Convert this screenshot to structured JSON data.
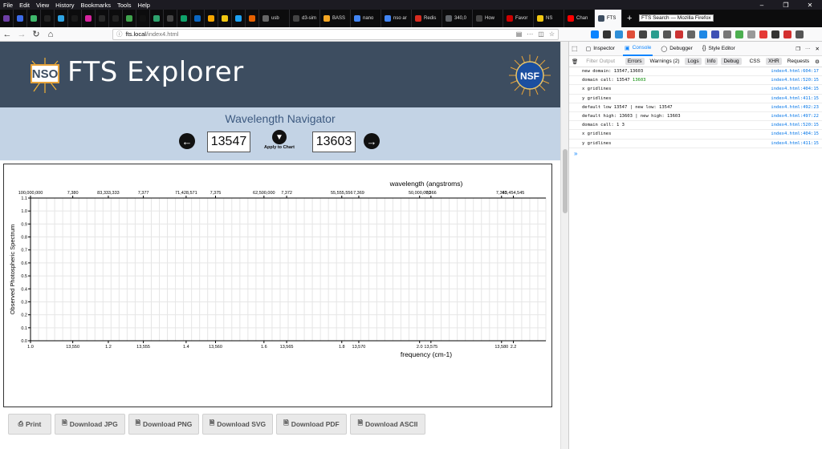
{
  "menubar": {
    "items": [
      "File",
      "Edit",
      "View",
      "History",
      "Bookmarks",
      "Tools",
      "Help"
    ]
  },
  "tabs": [
    {
      "label": "",
      "color": "#6e3fa6"
    },
    {
      "label": "",
      "color": "#3c6be8"
    },
    {
      "label": "",
      "color": "#3fb86b"
    },
    {
      "label": "",
      "color": "#222222"
    },
    {
      "label": "",
      "color": "#2ea3e3"
    },
    {
      "label": "",
      "color": "#1a1a1a"
    },
    {
      "label": "",
      "color": "#d6249f"
    },
    {
      "label": "",
      "color": "#2a2a2a"
    },
    {
      "label": "",
      "color": "#222222"
    },
    {
      "label": "",
      "color": "#3fa34d"
    },
    {
      "label": "",
      "color": "#111111"
    },
    {
      "label": "",
      "color": "#2ea36e"
    },
    {
      "label": "",
      "color": "#444444"
    },
    {
      "label": "",
      "color": "#0fa36b"
    },
    {
      "label": "",
      "color": "#0a66c2"
    },
    {
      "label": "",
      "color": "#f7a600"
    },
    {
      "label": "",
      "color": "#f2c811"
    },
    {
      "label": "",
      "color": "#1da1f2"
    },
    {
      "label": "",
      "color": "#e66000"
    },
    {
      "label": "usb",
      "color": "#666666"
    },
    {
      "label": "d3-sim",
      "color": "#444444"
    },
    {
      "label": "BASS",
      "color": "#f5a623"
    },
    {
      "label": "nano",
      "color": "#4285f4"
    },
    {
      "label": "nso ar",
      "color": "#4285f4"
    },
    {
      "label": "Redis",
      "color": "#d82c20"
    },
    {
      "label": "340,0",
      "color": "#5f6368"
    },
    {
      "label": "How",
      "color": "#444444"
    },
    {
      "label": "Favor",
      "color": "#cc0000"
    },
    {
      "label": "NS",
      "color": "#f2c811"
    },
    {
      "label": "Chan",
      "color": "#ff0000"
    },
    {
      "label": "FTS",
      "color": "#3d4d60"
    }
  ],
  "tab_tooltip": "FTS Search — Mozilla Firefox",
  "url": {
    "host": "fts.local",
    "path": "/index4.html"
  },
  "site": {
    "logo_text": "NSO",
    "title": "FTS Explorer",
    "seal_text": "NSF"
  },
  "navigator": {
    "title": "Wavelength Navigator",
    "low": "13547",
    "high": "13603",
    "apply_label": "Apply to Chart"
  },
  "chart_data": {
    "type": "line",
    "title": "",
    "top_axis_label": "wavelength (angstroms)",
    "xlabel": "frequency (cm-1)",
    "ylabel": "Observed Photospheric Spectrum",
    "ylim": [
      0.0,
      1.1
    ],
    "y_ticks": [
      "0.0",
      "0.1",
      "0.2",
      "0.3",
      "0.4",
      "0.5",
      "0.6",
      "0.7",
      "0.8",
      "0.9",
      "1.0",
      "1.1"
    ],
    "bottom_ticks": [
      {
        "label": "1.0",
        "pos": 0.0
      },
      {
        "label": "13,550",
        "pos": 0.082
      },
      {
        "label": "1.2",
        "pos": 0.151
      },
      {
        "label": "13,555",
        "pos": 0.219
      },
      {
        "label": "1.4",
        "pos": 0.302
      },
      {
        "label": "13,560",
        "pos": 0.359
      },
      {
        "label": "1.6",
        "pos": 0.453
      },
      {
        "label": "13,565",
        "pos": 0.497
      },
      {
        "label": "1.8",
        "pos": 0.604
      },
      {
        "label": "13,570",
        "pos": 0.637
      },
      {
        "label": "2.0",
        "pos": 0.755
      },
      {
        "label": "13,575",
        "pos": 0.777
      },
      {
        "label": "13,580",
        "pos": 0.914
      },
      {
        "label": "2.2",
        "pos": 0.937
      }
    ],
    "top_ticks": [
      {
        "label": "100,000,000",
        "pos": 0.0
      },
      {
        "label": "7,380",
        "pos": 0.082
      },
      {
        "label": "83,333,333",
        "pos": 0.151
      },
      {
        "label": "7,377",
        "pos": 0.219
      },
      {
        "label": "71,428,571",
        "pos": 0.302
      },
      {
        "label": "7,375",
        "pos": 0.359
      },
      {
        "label": "62,500,000",
        "pos": 0.453
      },
      {
        "label": "7,372",
        "pos": 0.497
      },
      {
        "label": "55,555,556",
        "pos": 0.604
      },
      {
        "label": "7,369",
        "pos": 0.637
      },
      {
        "label": "50,000,000",
        "pos": 0.755
      },
      {
        "label": "7,366",
        "pos": 0.777
      },
      {
        "label": "7,363",
        "pos": 0.914
      },
      {
        "label": "45,454,545",
        "pos": 0.937
      }
    ],
    "series": [],
    "grid": true
  },
  "download_buttons": [
    {
      "label": "Print",
      "icon": "printer-icon"
    },
    {
      "label": "Download JPG",
      "icon": "file-icon"
    },
    {
      "label": "Download PNG",
      "icon": "file-icon"
    },
    {
      "label": "Download SVG",
      "icon": "file-icon"
    },
    {
      "label": "Download PDF",
      "icon": "file-icon"
    },
    {
      "label": "Download ASCII",
      "icon": "file-icon"
    }
  ],
  "devtools": {
    "tabs": [
      "Inspector",
      "Console",
      "Debugger",
      "Style Editor"
    ],
    "active_tab": "Console",
    "filter_placeholder": "Filter Output",
    "filters": [
      "Errors",
      "Warnings (2)",
      "Logs",
      "Info",
      "Debug"
    ],
    "extra_filters": [
      "CSS",
      "XHR",
      "Requests"
    ],
    "logs": [
      {
        "msg": "new domain: 13547,13603",
        "num": "",
        "src": "index4.html:604:17"
      },
      {
        "msg": "domain call: 13547 ",
        "num": "13603",
        "src": "index4.html:520:15"
      },
      {
        "msg": "x gridlines",
        "num": "",
        "src": "index4.html:404:15"
      },
      {
        "msg": "y gridlines",
        "num": "",
        "src": "index4.html:411:15"
      },
      {
        "msg": "default low 13547 | new low: 13547",
        "num": "",
        "src": "index4.html:492:23"
      },
      {
        "msg": "default high: 13603 | new high: 13603",
        "num": "",
        "src": "index4.html:497:22"
      },
      {
        "msg": "domain call: 1 3",
        "num": "",
        "src": "index4.html:520:15"
      },
      {
        "msg": "x gridlines",
        "num": "",
        "src": "index4.html:404:15"
      },
      {
        "msg": "y gridlines",
        "num": "",
        "src": "index4.html:411:15"
      }
    ],
    "prompt": "»"
  }
}
